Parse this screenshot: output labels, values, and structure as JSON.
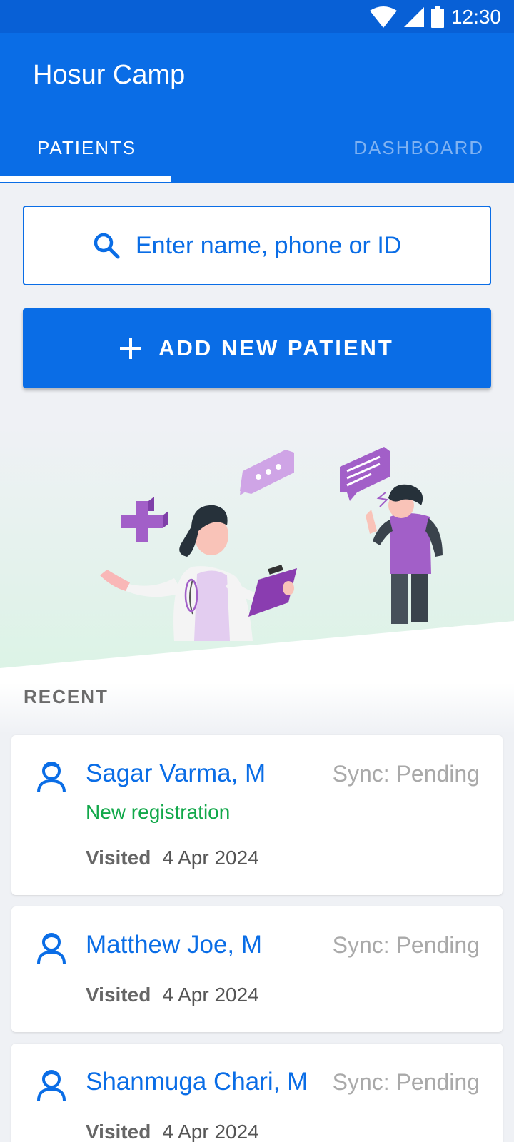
{
  "status_bar": {
    "time": "12:30",
    "icons": [
      "wifi-icon",
      "cellular-signal-icon",
      "battery-icon"
    ]
  },
  "app_bar": {
    "title": "Hosur Camp"
  },
  "tabs": [
    {
      "label": "PATIENTS",
      "active": true
    },
    {
      "label": "DASHBOARD",
      "active": false
    }
  ],
  "search": {
    "placeholder": "Enter name, phone or ID",
    "icon": "search-icon"
  },
  "add_button": {
    "label": "ADD NEW PATIENT",
    "icon": "plus-icon"
  },
  "recent": {
    "heading": "RECENT",
    "items": [
      {
        "name": "Sagar Varma, M",
        "sync": "Sync: Pending",
        "status": "New registration",
        "visited_label": "Visited",
        "visited_date": "4 Apr 2024"
      },
      {
        "name": "Matthew Joe, M",
        "sync": "Sync: Pending",
        "visited_label": "Visited",
        "visited_date": "4 Apr 2024"
      },
      {
        "name": "Shanmuga Chari, M",
        "sync": "Sync: Pending",
        "visited_label": "Visited",
        "visited_date": "4 Apr 2024"
      }
    ]
  },
  "colors": {
    "primary": "#0a6de6",
    "status_bar": "#0860d6",
    "success": "#12a84a",
    "muted": "#a9a9a9",
    "background": "#eff1f5",
    "accent_purple": "#a25fc8"
  }
}
